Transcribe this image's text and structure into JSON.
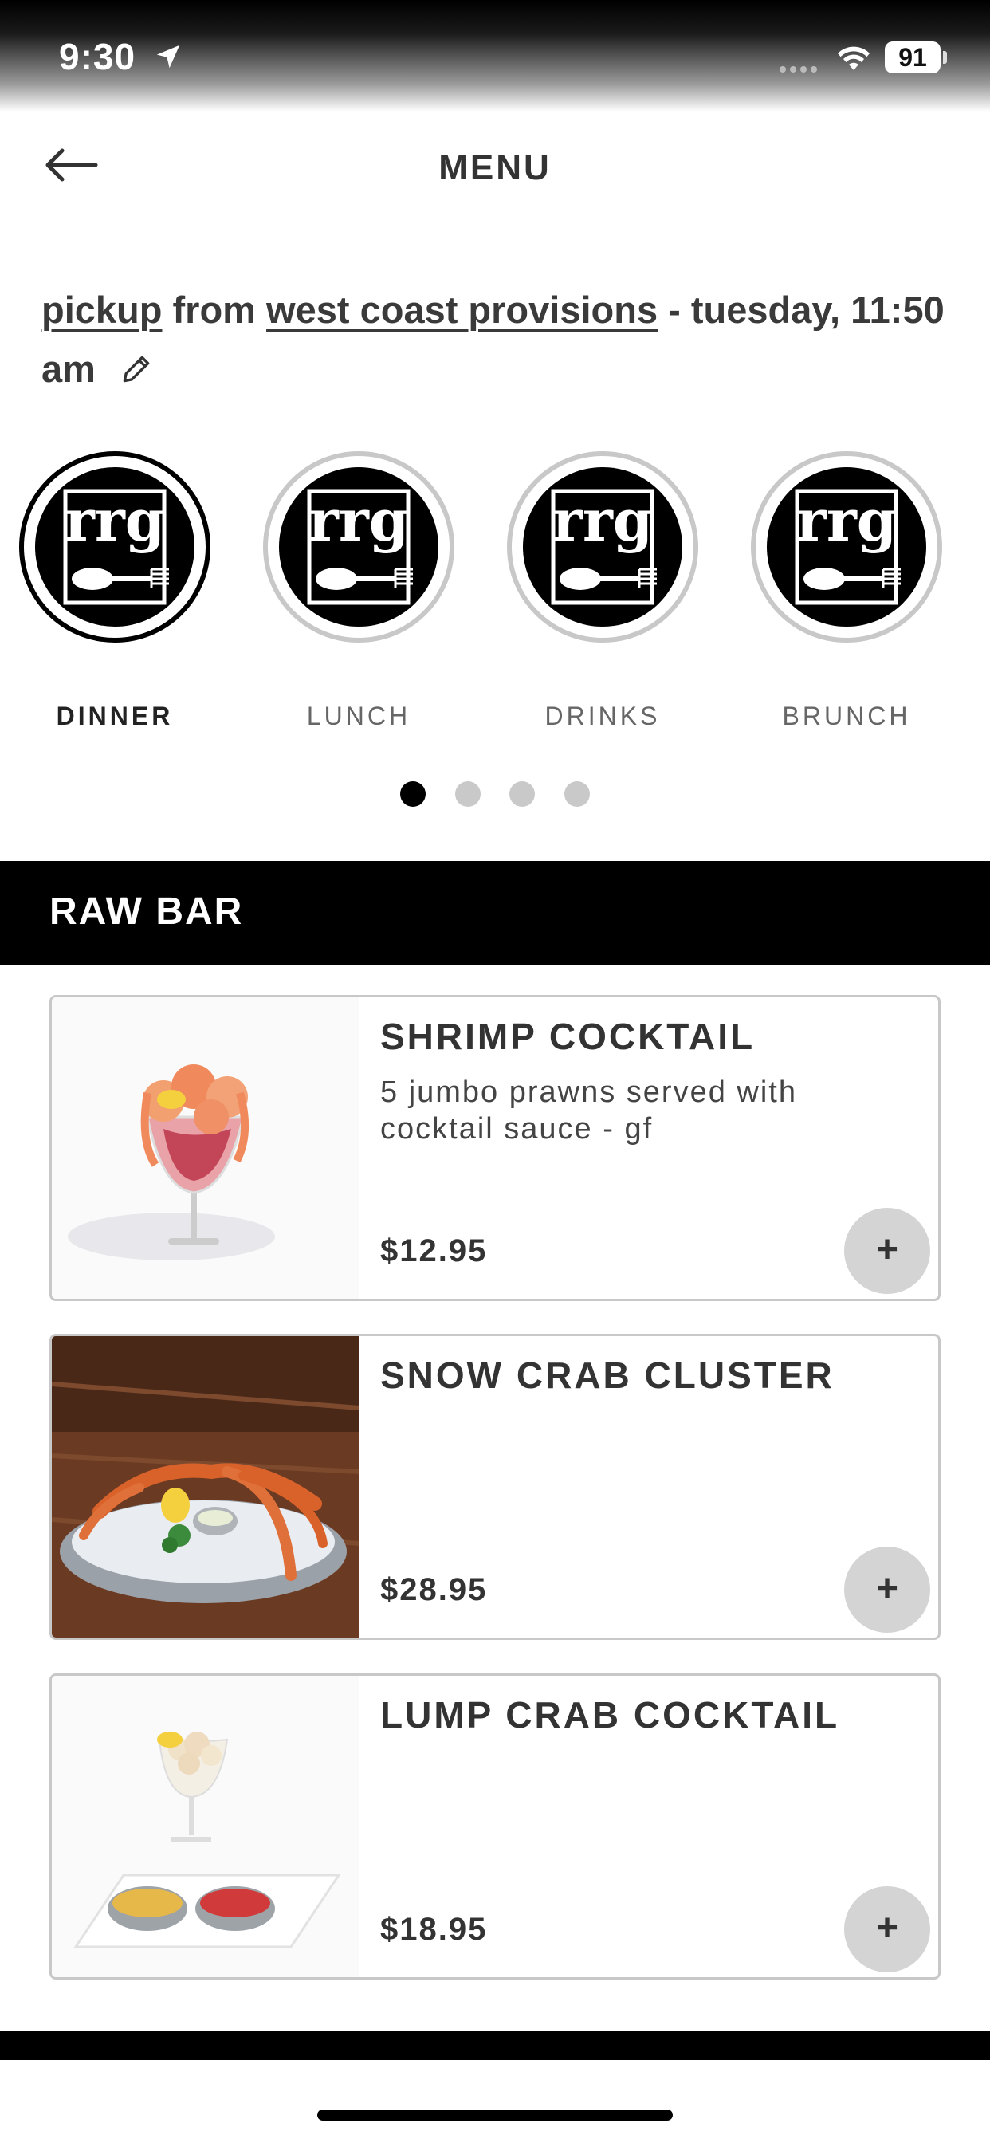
{
  "status": {
    "time": "9:30",
    "battery": "91"
  },
  "header": {
    "title": "MENU"
  },
  "pickup": {
    "method": "pickup",
    "connector": "from",
    "location": "west coast provisions",
    "time": "- tuesday, 11:50 am"
  },
  "categories": [
    {
      "label": "DINNER",
      "logo": "rrg"
    },
    {
      "label": "LUNCH",
      "logo": "rrg"
    },
    {
      "label": "DRINKS",
      "logo": "rrg"
    },
    {
      "label": "BRUNCH",
      "logo": "rrg"
    }
  ],
  "section": {
    "title": "RAW BAR"
  },
  "items": [
    {
      "name": "SHRIMP COCKTAIL",
      "description": "5 jumbo prawns served with cocktail sauce - gf",
      "price": "$12.95",
      "add": "+"
    },
    {
      "name": "SNOW CRAB CLUSTER",
      "description": "",
      "price": "$28.95",
      "add": "+"
    },
    {
      "name": "LUMP CRAB COCKTAIL",
      "description": "",
      "price": "$18.95",
      "add": "+"
    }
  ],
  "colors": {
    "accent": "#000000",
    "inactive": "#c8c8c8",
    "addButton": "#d4d4d4"
  }
}
